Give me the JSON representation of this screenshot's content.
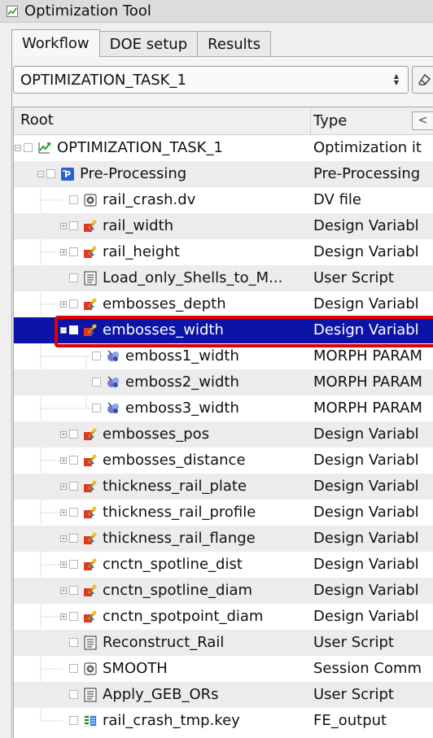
{
  "window": {
    "title": "Optimization Tool"
  },
  "tabs": [
    {
      "label": "Workflow",
      "active": true
    },
    {
      "label": "DOE setup",
      "active": false
    },
    {
      "label": "Results",
      "active": false
    }
  ],
  "task_selector": {
    "value": "OPTIMIZATION_TASK_1"
  },
  "tree": {
    "columns": {
      "root": "Root",
      "type": "Type"
    },
    "rows": [
      {
        "name": "OPTIMIZATION_TASK_1",
        "type": "Optimization it",
        "icon": "optimization-task-icon",
        "indent": 0,
        "expander": "minus"
      },
      {
        "name": "Pre-Processing",
        "type": "Pre-Processing",
        "icon": "preprocessing-icon",
        "indent": 1,
        "expander": "minus"
      },
      {
        "name": "rail_crash.dv",
        "type": "DV file",
        "icon": "dv-file-icon",
        "indent": 2,
        "expander": ""
      },
      {
        "name": "rail_width",
        "type": "Design Variabl",
        "icon": "design-variable-icon",
        "indent": 2,
        "expander": "plus"
      },
      {
        "name": "rail_height",
        "type": "Design Variabl",
        "icon": "design-variable-icon",
        "indent": 2,
        "expander": "plus"
      },
      {
        "name": "Load_only_Shells_to_M...",
        "type": "User Script",
        "icon": "user-script-icon",
        "indent": 2,
        "expander": ""
      },
      {
        "name": "embosses_depth",
        "type": "Design Variabl",
        "icon": "design-variable-icon",
        "indent": 2,
        "expander": "plus"
      },
      {
        "name": "embosses_width",
        "type": "Design Variabl",
        "icon": "design-variable-icon",
        "indent": 2,
        "expander": "minus",
        "selected": true
      },
      {
        "name": "emboss1_width",
        "type": "MORPH PARAM",
        "icon": "morph-param-icon",
        "indent": 3,
        "expander": ""
      },
      {
        "name": "emboss2_width",
        "type": "MORPH PARAM",
        "icon": "morph-param-icon",
        "indent": 3,
        "expander": ""
      },
      {
        "name": "emboss3_width",
        "type": "MORPH PARAM",
        "icon": "morph-param-icon",
        "indent": 3,
        "expander": ""
      },
      {
        "name": "embosses_pos",
        "type": "Design Variabl",
        "icon": "design-variable-icon",
        "indent": 2,
        "expander": "plus"
      },
      {
        "name": "embosses_distance",
        "type": "Design Variabl",
        "icon": "design-variable-icon",
        "indent": 2,
        "expander": "plus"
      },
      {
        "name": "thickness_rail_plate",
        "type": "Design Variabl",
        "icon": "design-variable-icon",
        "indent": 2,
        "expander": "plus"
      },
      {
        "name": "thickness_rail_profile",
        "type": "Design Variabl",
        "icon": "design-variable-icon",
        "indent": 2,
        "expander": "plus"
      },
      {
        "name": "thickness_rail_flange",
        "type": "Design Variabl",
        "icon": "design-variable-icon",
        "indent": 2,
        "expander": "plus"
      },
      {
        "name": "cnctn_spotline_dist",
        "type": "Design Variabl",
        "icon": "design-variable-icon",
        "indent": 2,
        "expander": "plus"
      },
      {
        "name": "cnctn_spotline_diam",
        "type": "Design Variabl",
        "icon": "design-variable-icon",
        "indent": 2,
        "expander": "plus"
      },
      {
        "name": "cnctn_spotpoint_diam",
        "type": "Design Variabl",
        "icon": "design-variable-icon",
        "indent": 2,
        "expander": "plus"
      },
      {
        "name": "Reconstruct_Rail",
        "type": "User Script",
        "icon": "user-script-icon",
        "indent": 2,
        "expander": ""
      },
      {
        "name": "SMOOTH",
        "type": "Session Comm",
        "icon": "session-command-icon",
        "indent": 2,
        "expander": ""
      },
      {
        "name": "Apply_GEB_ORs",
        "type": "User Script",
        "icon": "user-script-icon",
        "indent": 2,
        "expander": ""
      },
      {
        "name": "rail_crash_tmp.key",
        "type": "FE_output",
        "icon": "fe-output-icon",
        "indent": 2,
        "expander": ""
      }
    ]
  },
  "colors": {
    "selection": "#0c14a8",
    "highlight": "#e00000",
    "alt_row": "#ececec"
  }
}
